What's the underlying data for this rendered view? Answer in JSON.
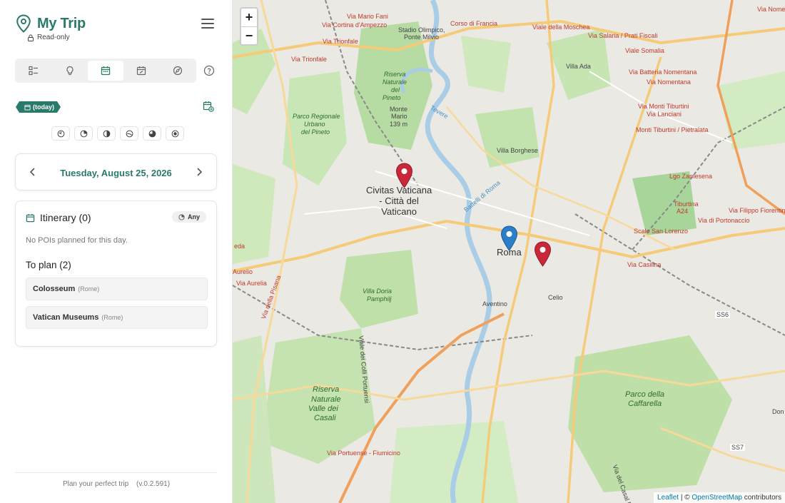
{
  "app": {
    "title": "My Trip",
    "readonly_label": "Read-only"
  },
  "nav": {
    "tabs": [
      "list",
      "ideas",
      "calendar",
      "calendar-edit",
      "explore"
    ]
  },
  "day": {
    "today_label": "(today)",
    "time_filters": [
      "morning",
      "midday",
      "afternoon",
      "evening",
      "night",
      "all"
    ],
    "date": "Tuesday, August 25, 2026"
  },
  "itinerary": {
    "title": "Itinerary (0)",
    "any_label": "Any",
    "empty_message": "No POIs planned for this day.",
    "to_plan_title": "To plan (2)",
    "items": [
      {
        "name": "Colosseum",
        "city": "(Rome)"
      },
      {
        "name": "Vatican Museums",
        "city": "(Rome)"
      }
    ]
  },
  "footer": {
    "tagline": "Plan your perfect trip",
    "version": "(v.0.2.591)"
  },
  "map": {
    "zoom_in": "+",
    "zoom_out": "−",
    "places": {
      "vatican_line1": "Civitas Vaticana",
      "vatican_line2": "- Città del",
      "vatican_line3": "Vaticano",
      "roma": "Roma"
    },
    "street_labels": {
      "mario_fani": "Via Mario Fani",
      "cortina": "Via Cortina d'Ampezzo",
      "trionfale_1": "Via Trionfale",
      "trionfale_2": "Via Trionfale",
      "corso_francia": "Corso di Francia",
      "moschea": "Viale della Moschea",
      "salaria": "Via Salaria / Prati Fiscali",
      "somalia": "Viale Somalia",
      "batteria": "Via Batteria Nomentana",
      "nomentana": "Via Nomentana",
      "monti_1": "Via Monti Tiburtini",
      "lanciani": "Via Lanciani",
      "monti_2": "Monti Tiburtini / Pietralata",
      "filippo": "Via Filippo Fiorentini",
      "portonaccio": "Via di Portonaccio",
      "tiburtina": "Tiburtina",
      "a24": "A24",
      "scalo": "Scalo San Lorenzo",
      "casilina": "Via Casilina",
      "portuense": "Via Portuense - Fiumicino",
      "aurelio_1": "Aurelio",
      "aurelio_2": "Via Aurelia",
      "pisana": "Via della Pisana",
      "nomen_trunc": "Via Nomen",
      "lgo_zamesena": "Lgo Zamesena",
      "eda": "eda",
      "don": "Don"
    },
    "dark_labels": {
      "stadio": "Stadio Olimpico,",
      "ponte_milvio": "Ponte Milvio",
      "monte_mario": "Monte",
      "monte_mario_2": "Mario",
      "monte_mario_3": "139 m",
      "villa_borghese": "Villa Borghese",
      "villa_ada": "Villa Ada",
      "aventino": "Aventino",
      "celio": "Celio",
      "ss6": "SS6",
      "ss7": "SS7",
      "tevere": "Tevere",
      "battelli": "Battelli di Roma",
      "via_casali": "Via del Casal Pazzuolo",
      "viale_colli": "Viale dei Colli Portuensi"
    },
    "park_labels": {
      "insugherata_1": "Riserva",
      "insugherata_2": "Naturale",
      "insugherata_3": "del",
      "insugherata_4": "Pineto",
      "pineto_1": "Parco Regionale",
      "pineto_2": "Urbano",
      "pineto_3": "del Pineto",
      "doria_1": "Villa Doria",
      "doria_2": "Pamphilj",
      "casali_1": "Riserva",
      "casali_2": "Naturale",
      "casali_3": "Valle dei",
      "casali_4": "Casali",
      "caffarella_1": "Parco della",
      "caffarella_2": "Caffarella"
    },
    "attribution": {
      "leaflet": "Leaflet",
      "sep": " | © ",
      "osm": "OpenStreetMap",
      "contributors": " contributors"
    }
  }
}
